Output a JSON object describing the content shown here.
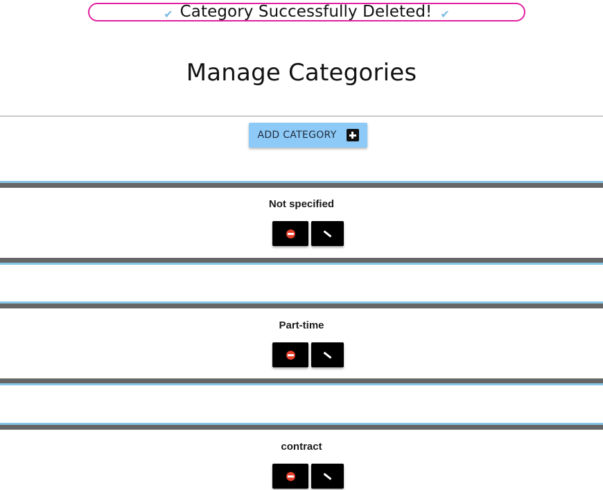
{
  "toast": {
    "message": "Category Successfully Deleted!",
    "icon": "check-icon"
  },
  "page": {
    "title": "Manage Categories"
  },
  "toolbar": {
    "add_label": "ADD CATEGORY",
    "add_icon": "plus-square-icon"
  },
  "categories": [
    {
      "name": "Not specified"
    },
    {
      "name": "Part-time"
    },
    {
      "name": "contract"
    }
  ],
  "colors": {
    "toast_border": "#e020a0",
    "check": "#7bbde3",
    "add_button": "#8ecaf7",
    "bar_dark": "#666666",
    "bar_light": "#86c4e6",
    "delete_icon": "#e8412c"
  }
}
